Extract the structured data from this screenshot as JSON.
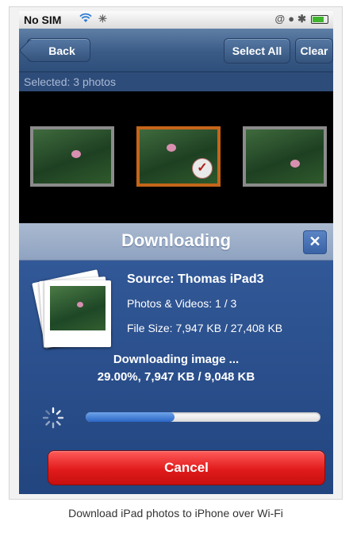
{
  "status_bar": {
    "carrier": "No SIM",
    "wifi_icon": "wifi-icon",
    "activity_icon": "activity-spinner-icon",
    "right_icons": [
      "at-icon",
      "lock-icon",
      "bluetooth-icon",
      "battery-icon"
    ]
  },
  "nav": {
    "back_label": "Back",
    "select_all_label": "Select All",
    "clear_label": "Clear"
  },
  "selection": {
    "label": "Selected: 3 photos"
  },
  "thumbnails": [
    {
      "selected": false
    },
    {
      "selected": true,
      "check": "✓"
    },
    {
      "selected": false
    }
  ],
  "dialog": {
    "title": "Downloading",
    "close_label": "✕",
    "source": "Source: Thomas iPad3",
    "photos_videos": "Photos & Videos: 1 / 3",
    "file_size": "File Size: 7,947 KB / 27,408 KB",
    "status_line1": "Downloading image ...",
    "status_line2": "29.00%, 7,947 KB / 9,048 KB",
    "progress_fraction": 0.38,
    "cancel_label": "Cancel"
  },
  "caption": "Download iPad photos to iPhone over Wi-Fi",
  "colors": {
    "nav": "#3a5b86",
    "dialog": "#22457f",
    "cancel": "#e11b1b",
    "selected_border": "#c5651a",
    "progress": "#2a66c6"
  }
}
